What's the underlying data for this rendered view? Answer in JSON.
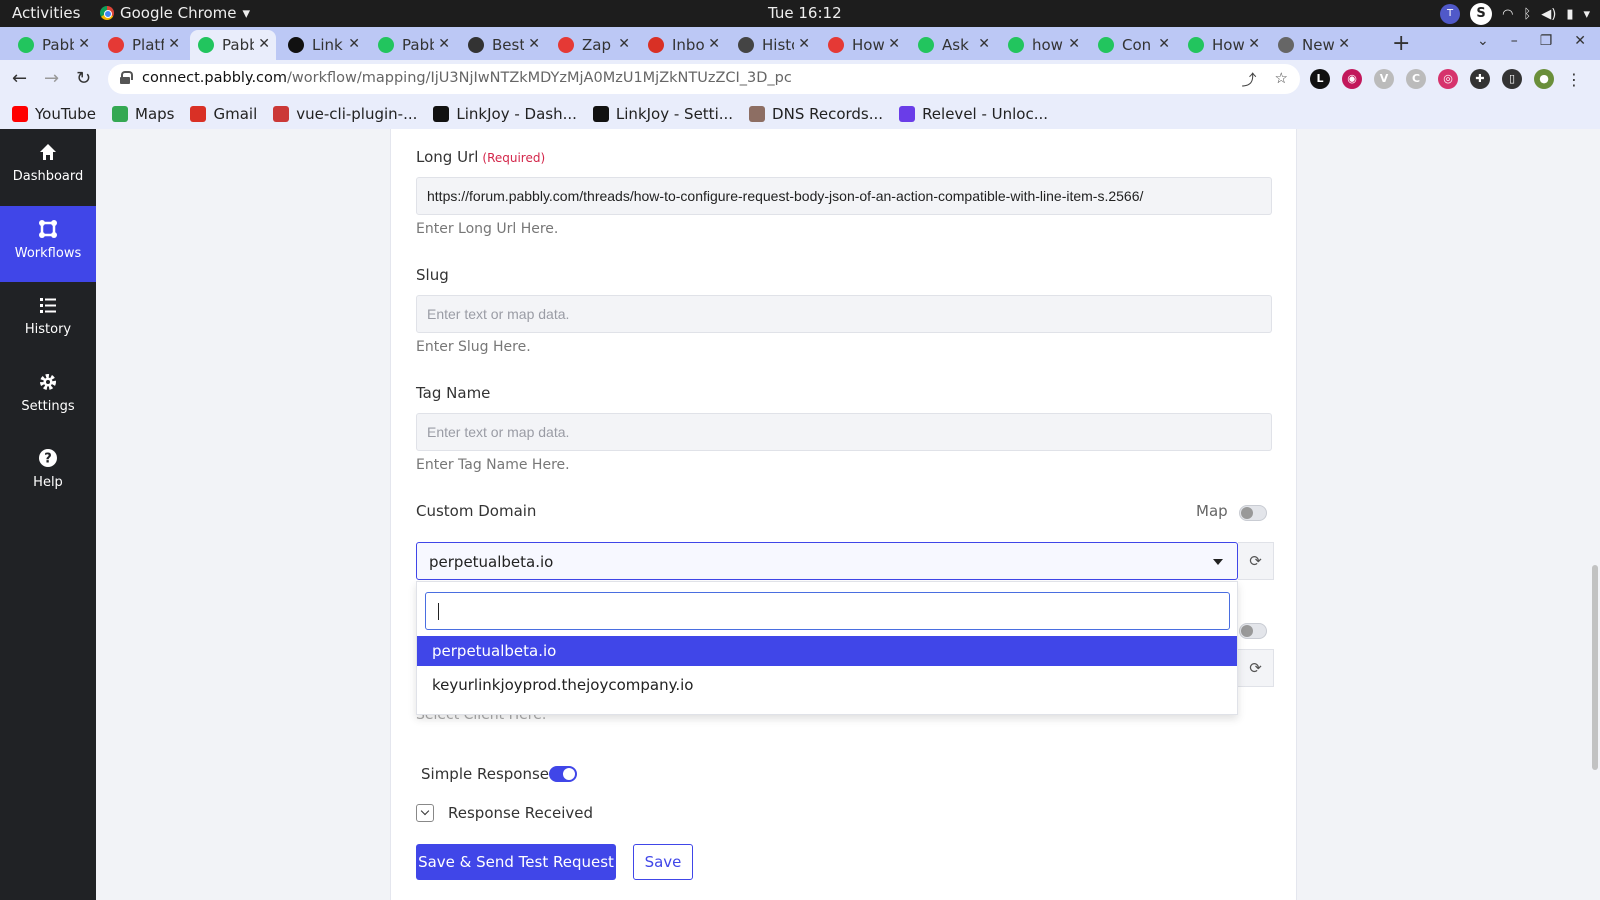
{
  "os": {
    "activities": "Activities",
    "app_name": "Google Chrome",
    "clock": "Tue 16:12"
  },
  "tabs": [
    {
      "title": "Pabb",
      "favicon": "pabbly-icon",
      "color": "#22c55e"
    },
    {
      "title": "Platf",
      "favicon": "document-icon",
      "color": "#e53935"
    },
    {
      "title": "Pabb",
      "favicon": "pabbly-icon",
      "color": "#22c55e",
      "active": true
    },
    {
      "title": "Link",
      "favicon": "linkjoy-icon",
      "color": "#111111"
    },
    {
      "title": "Pabb",
      "favicon": "pabbly-icon",
      "color": "#22c55e"
    },
    {
      "title": "Best",
      "favicon": "jf-icon",
      "color": "#333333"
    },
    {
      "title": "Zap",
      "favicon": "document-icon",
      "color": "#e53935"
    },
    {
      "title": "Inbo",
      "favicon": "gmail-icon",
      "color": "#d93025"
    },
    {
      "title": "Histo",
      "favicon": "history-icon",
      "color": "#444444"
    },
    {
      "title": "How",
      "favicon": "document-icon",
      "color": "#e53935"
    },
    {
      "title": "Ask",
      "favicon": "pabbly-icon",
      "color": "#22c55e"
    },
    {
      "title": "how",
      "favicon": "pabbly-icon",
      "color": "#22c55e"
    },
    {
      "title": "Con",
      "favicon": "pabbly-icon",
      "color": "#22c55e"
    },
    {
      "title": "How",
      "favicon": "pabbly-icon",
      "color": "#22c55e"
    },
    {
      "title": "New",
      "favicon": "chrome-icon",
      "color": "#666666"
    }
  ],
  "omnibox": {
    "host": "connect.pabbly.com",
    "path": "/workflow/mapping/IjU3NjIwNTZkMDYzMjA0MzU1MjZkNTUzZCI_3D_pc"
  },
  "bookmarks": [
    {
      "label": "YouTube",
      "icon": "youtube-icon",
      "color": "#ff0000"
    },
    {
      "label": "Maps",
      "icon": "maps-icon",
      "color": "#34a853"
    },
    {
      "label": "Gmail",
      "icon": "gmail-icon",
      "color": "#d93025"
    },
    {
      "label": "vue-cli-plugin-...",
      "icon": "npm-icon",
      "color": "#cb3837"
    },
    {
      "label": "LinkJoy - Dash...",
      "icon": "linkjoy-icon",
      "color": "#111111"
    },
    {
      "label": "LinkJoy - Setti...",
      "icon": "linkjoy-icon",
      "color": "#111111"
    },
    {
      "label": "DNS Records...",
      "icon": "person-icon",
      "color": "#8d6e63"
    },
    {
      "label": "Relevel - Unloc...",
      "icon": "relevel-icon",
      "color": "#6a3de8"
    }
  ],
  "sidebar": {
    "items": [
      {
        "label": "Dashboard",
        "icon": "home-icon"
      },
      {
        "label": "Workflows",
        "icon": "workflows-icon",
        "active": true
      },
      {
        "label": "History",
        "icon": "list-icon"
      },
      {
        "label": "Settings",
        "icon": "gear-icon"
      },
      {
        "label": "Help",
        "icon": "help-icon"
      }
    ]
  },
  "form": {
    "long_url": {
      "label": "Long Url",
      "required": "(Required)",
      "value": "https://forum.pabbly.com/threads/how-to-configure-request-body-json-of-an-action-compatible-with-line-item-s.2566/",
      "help": "Enter Long Url Here."
    },
    "slug": {
      "label": "Slug",
      "placeholder": "Enter text or map data.",
      "help": "Enter Slug Here."
    },
    "tag_name": {
      "label": "Tag Name",
      "placeholder": "Enter text or map data.",
      "help": "Enter Tag Name Here."
    },
    "custom_domain": {
      "label": "Custom Domain",
      "map_label": "Map",
      "selected": "perpetualbeta.io",
      "options": [
        "perpetualbeta.io",
        "keyurlinkjoyprod.thejoycompany.io"
      ]
    },
    "client_help": "Select Client Here.",
    "simple_response": {
      "label": "Simple Response",
      "enabled": true
    },
    "response_received": "Response Received",
    "save_send_label": "Save & Send Test Request",
    "save_label": "Save"
  },
  "colors": {
    "accent": "#4046e8",
    "sidebar_bg": "#202225",
    "required": "#d3264a"
  }
}
